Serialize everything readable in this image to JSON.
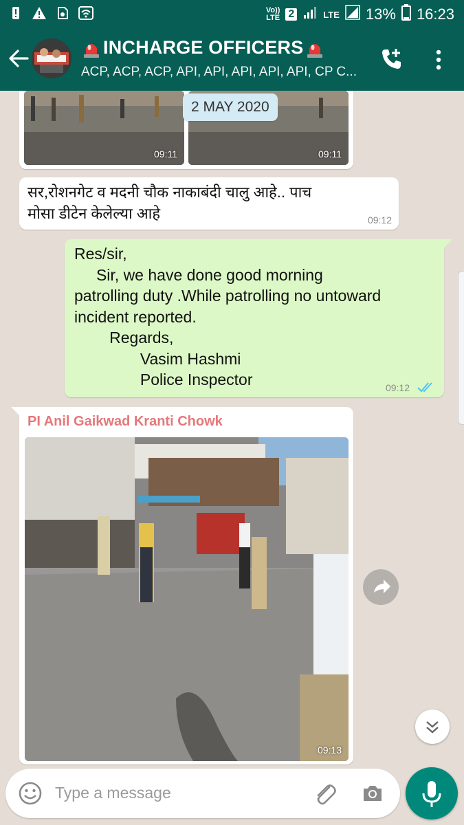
{
  "status_bar": {
    "network_label_top": "Vo))",
    "network_label_bottom": "LTE",
    "sim_badge": "2",
    "lte_label": "LTE",
    "battery": "13%",
    "time": "16:23"
  },
  "header": {
    "title": "INCHARGE OFFICERS",
    "subtitle": "ACP, ACP, ACP, API, API, API, API, API, CP C..."
  },
  "chat": {
    "date_chip": "2 MAY 2020",
    "messages": [
      {
        "type": "image_pair",
        "direction": "in",
        "times": [
          "09:11",
          "09:11"
        ]
      },
      {
        "type": "text",
        "direction": "in",
        "text": "सर,रोशनगेट व मदनी चौक नाकाबंदी चालु आहे.. पाच\nमोसा डीटेन केलेल्या आहे",
        "time": "09:12"
      },
      {
        "type": "text",
        "direction": "out",
        "text": "Res/sir,\n     Sir, we have done good morning\npatrolling duty .While patrolling no untoward\nincident reported.\n        Regards,\n               Vasim Hashmi\n               Police Inspector",
        "time": "09:12",
        "read_receipt": "double-check-blue"
      },
      {
        "type": "image",
        "direction": "in",
        "sender": "PI Anil Gaikwad Kranti Chowk",
        "time": "09:13"
      }
    ]
  },
  "composer": {
    "placeholder": "Type a message"
  },
  "colors": {
    "header": "#075e54",
    "background": "#e5ddd5",
    "outgoing": "#dcf8c6",
    "incoming": "#ffffff",
    "sender": "#e5787b",
    "fab": "#00897b",
    "read_tick": "#4fc3f7"
  },
  "icons": [
    "back-arrow-icon",
    "siren-icon",
    "add-call-icon",
    "more-vert-icon",
    "share-icon",
    "scroll-down-icon",
    "emoji-icon",
    "attach-icon",
    "camera-icon",
    "mic-icon",
    "double-check-icon"
  ]
}
